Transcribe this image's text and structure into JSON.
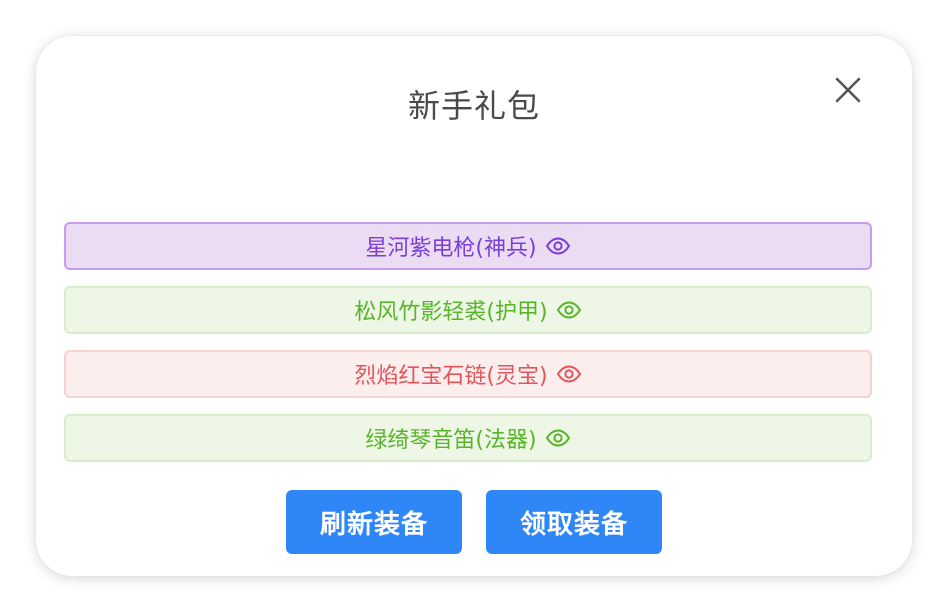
{
  "dialog": {
    "title": "新手礼包"
  },
  "items": [
    {
      "label": "星河紫电枪(神兵)",
      "color": "purple",
      "icon": "eye-icon"
    },
    {
      "label": "松风竹影轻裘(护甲)",
      "color": "green",
      "icon": "eye-icon"
    },
    {
      "label": "烈焰红宝石链(灵宝)",
      "color": "red",
      "icon": "eye-icon"
    },
    {
      "label": "绿绮琴音笛(法器)",
      "color": "green",
      "icon": "eye-icon"
    }
  ],
  "buttons": {
    "refresh_label": "刷新装备",
    "claim_label": "领取装备"
  },
  "colors": {
    "primary": "#2f86f6",
    "purple_text": "#7b3fd6",
    "green_text": "#58b52a",
    "red_text": "#e0565c"
  }
}
